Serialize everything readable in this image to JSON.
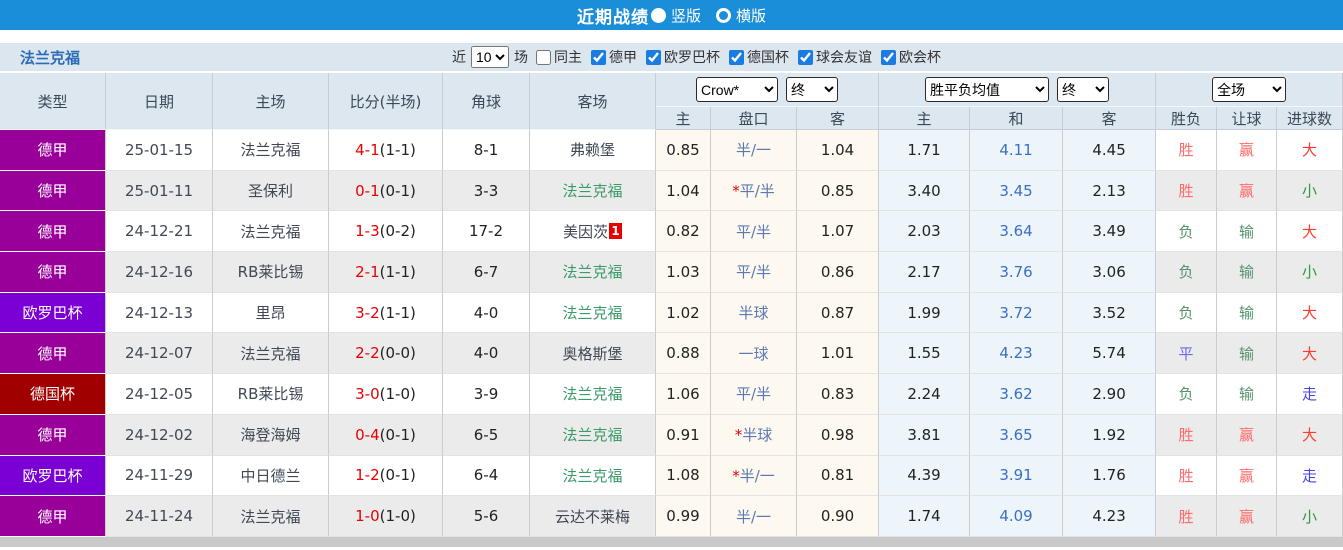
{
  "colors": {
    "titlebar_bg": "#1b8ed9",
    "toolbar_bg": "#dce6ef",
    "header_bg": "#dde7f0",
    "league_bundesliga": "#990099",
    "league_europa": "#7a00d4",
    "league_dfb_pokal": "#a00000",
    "team_self_green": "#3a9a68",
    "score_red": "#e60000",
    "handicap_blue": "#5b79b2",
    "avg_draw_blue": "#3a6fc4",
    "win_red": "#ff6a6a",
    "lose_green": "#55936b",
    "draw_blue": "#6a6ae8",
    "big_red": "#ff3b30",
    "small_green": "#2f9a44",
    "go_blue": "#4646dd"
  },
  "title_bar": {
    "title": "近期战绩",
    "vertical_label": "竖版",
    "horizontal_label": "横版",
    "selected": "竖版"
  },
  "toolbar": {
    "team": "法兰克福",
    "recent_label": "近",
    "recent_count": "10",
    "games_label": "场",
    "same_home_label": "同主",
    "same_home_checked": false,
    "filters": [
      {
        "label": "德甲",
        "checked": true
      },
      {
        "label": "欧罗巴杯",
        "checked": true
      },
      {
        "label": "德国杯",
        "checked": true
      },
      {
        "label": "球会友谊",
        "checked": true
      },
      {
        "label": "欧会杯",
        "checked": true
      }
    ]
  },
  "table": {
    "main_headers": [
      "类型",
      "日期",
      "主场",
      "比分(半场)",
      "角球",
      "客场"
    ],
    "odds_group": {
      "company_select": "Crow*",
      "time_select": "终",
      "sub_headers": [
        "主",
        "盘口",
        "客"
      ]
    },
    "avg_group": {
      "type_select": "胜平负均值",
      "time_select": "终",
      "sub_headers": [
        "主",
        "和",
        "客"
      ]
    },
    "result_group": {
      "scope_select": "全场",
      "sub_headers": [
        "胜负",
        "让球",
        "进球数"
      ]
    },
    "rows": [
      {
        "league": "德甲",
        "league_class": "lg-bund",
        "date": "25-01-15",
        "home": "法兰克福",
        "home_class": "self",
        "score": "4-1",
        "half": "(1-1)",
        "corner": "8-1",
        "away": "弗赖堡",
        "away_class": "",
        "away_badge": "",
        "odds_home": "0.85",
        "pan_star": "",
        "pan": "半/一",
        "odds_away": "1.04",
        "avg_home": "1.71",
        "avg_draw": "4.11",
        "avg_away": "4.45",
        "res_wdl": "胜",
        "res_wdl_class": "win",
        "res_handicap": "赢",
        "res_handicap_class": "win",
        "res_goals": "大",
        "res_goals_class": "big"
      },
      {
        "league": "德甲",
        "league_class": "lg-bund",
        "date": "25-01-11",
        "home": "圣保利",
        "home_class": "",
        "score": "0-1",
        "half": "(0-1)",
        "corner": "3-3",
        "away": "法兰克福",
        "away_class": "self",
        "away_badge": "",
        "odds_home": "1.04",
        "pan_star": "*",
        "pan": "平/半",
        "odds_away": "0.85",
        "avg_home": "3.40",
        "avg_draw": "3.45",
        "avg_away": "2.13",
        "res_wdl": "胜",
        "res_wdl_class": "win",
        "res_handicap": "赢",
        "res_handicap_class": "win",
        "res_goals": "小",
        "res_goals_class": "small"
      },
      {
        "league": "德甲",
        "league_class": "lg-bund",
        "date": "24-12-21",
        "home": "法兰克福",
        "home_class": "self",
        "score": "1-3",
        "half": "(0-2)",
        "corner": "17-2",
        "away": "美因茨",
        "away_class": "",
        "away_badge": "1",
        "odds_home": "0.82",
        "pan_star": "",
        "pan": "平/半",
        "odds_away": "1.07",
        "avg_home": "2.03",
        "avg_draw": "3.64",
        "avg_away": "3.49",
        "res_wdl": "负",
        "res_wdl_class": "lose",
        "res_handicap": "输",
        "res_handicap_class": "lose",
        "res_goals": "大",
        "res_goals_class": "big"
      },
      {
        "league": "德甲",
        "league_class": "lg-bund",
        "date": "24-12-16",
        "home": "RB莱比锡",
        "home_class": "",
        "score": "2-1",
        "half": "(1-1)",
        "corner": "6-7",
        "away": "法兰克福",
        "away_class": "self",
        "away_badge": "",
        "odds_home": "1.03",
        "pan_star": "",
        "pan": "平/半",
        "odds_away": "0.86",
        "avg_home": "2.17",
        "avg_draw": "3.76",
        "avg_away": "3.06",
        "res_wdl": "负",
        "res_wdl_class": "lose",
        "res_handicap": "输",
        "res_handicap_class": "lose",
        "res_goals": "小",
        "res_goals_class": "small"
      },
      {
        "league": "欧罗巴杯",
        "league_class": "lg-europa",
        "date": "24-12-13",
        "home": "里昂",
        "home_class": "",
        "score": "3-2",
        "half": "(1-1)",
        "corner": "4-0",
        "away": "法兰克福",
        "away_class": "self",
        "away_badge": "",
        "odds_home": "1.02",
        "pan_star": "",
        "pan": "半球",
        "odds_away": "0.87",
        "avg_home": "1.99",
        "avg_draw": "3.72",
        "avg_away": "3.52",
        "res_wdl": "负",
        "res_wdl_class": "lose",
        "res_handicap": "输",
        "res_handicap_class": "lose",
        "res_goals": "大",
        "res_goals_class": "big"
      },
      {
        "league": "德甲",
        "league_class": "lg-bund",
        "date": "24-12-07",
        "home": "法兰克福",
        "home_class": "self",
        "score": "2-2",
        "half": "(0-0)",
        "corner": "4-0",
        "away": "奥格斯堡",
        "away_class": "",
        "away_badge": "",
        "odds_home": "0.88",
        "pan_star": "",
        "pan": "一球",
        "odds_away": "1.01",
        "avg_home": "1.55",
        "avg_draw": "4.23",
        "avg_away": "5.74",
        "res_wdl": "平",
        "res_wdl_class": "draw",
        "res_handicap": "输",
        "res_handicap_class": "lose",
        "res_goals": "大",
        "res_goals_class": "big"
      },
      {
        "league": "德国杯",
        "league_class": "lg-dfb",
        "date": "24-12-05",
        "home": "RB莱比锡",
        "home_class": "",
        "score": "3-0",
        "half": "(1-0)",
        "corner": "3-9",
        "away": "法兰克福",
        "away_class": "self",
        "away_badge": "",
        "odds_home": "1.06",
        "pan_star": "",
        "pan": "平/半",
        "odds_away": "0.83",
        "avg_home": "2.24",
        "avg_draw": "3.62",
        "avg_away": "2.90",
        "res_wdl": "负",
        "res_wdl_class": "lose",
        "res_handicap": "输",
        "res_handicap_class": "lose",
        "res_goals": "走",
        "res_goals_class": "go"
      },
      {
        "league": "德甲",
        "league_class": "lg-bund",
        "date": "24-12-02",
        "home": "海登海姆",
        "home_class": "",
        "score": "0-4",
        "half": "(0-1)",
        "corner": "6-5",
        "away": "法兰克福",
        "away_class": "self",
        "away_badge": "",
        "odds_home": "0.91",
        "pan_star": "*",
        "pan": "半球",
        "odds_away": "0.98",
        "avg_home": "3.81",
        "avg_draw": "3.65",
        "avg_away": "1.92",
        "res_wdl": "胜",
        "res_wdl_class": "win",
        "res_handicap": "赢",
        "res_handicap_class": "win",
        "res_goals": "大",
        "res_goals_class": "big"
      },
      {
        "league": "欧罗巴杯",
        "league_class": "lg-europa",
        "date": "24-11-29",
        "home": "中日德兰",
        "home_class": "",
        "score": "1-2",
        "half": "(0-1)",
        "corner": "6-4",
        "away": "法兰克福",
        "away_class": "self",
        "away_badge": "",
        "odds_home": "1.08",
        "pan_star": "*",
        "pan": "半/一",
        "odds_away": "0.81",
        "avg_home": "4.39",
        "avg_draw": "3.91",
        "avg_away": "1.76",
        "res_wdl": "胜",
        "res_wdl_class": "win",
        "res_handicap": "赢",
        "res_handicap_class": "win",
        "res_goals": "走",
        "res_goals_class": "go"
      },
      {
        "league": "德甲",
        "league_class": "lg-bund",
        "date": "24-11-24",
        "home": "法兰克福",
        "home_class": "self",
        "score": "1-0",
        "half": "(1-0)",
        "corner": "5-6",
        "away": "云达不莱梅",
        "away_class": "",
        "away_badge": "",
        "odds_home": "0.99",
        "pan_star": "",
        "pan": "半/一",
        "odds_away": "0.90",
        "avg_home": "1.74",
        "avg_draw": "4.09",
        "avg_away": "4.23",
        "res_wdl": "胜",
        "res_wdl_class": "win",
        "res_handicap": "赢",
        "res_handicap_class": "win",
        "res_goals": "小",
        "res_goals_class": "small"
      }
    ]
  }
}
